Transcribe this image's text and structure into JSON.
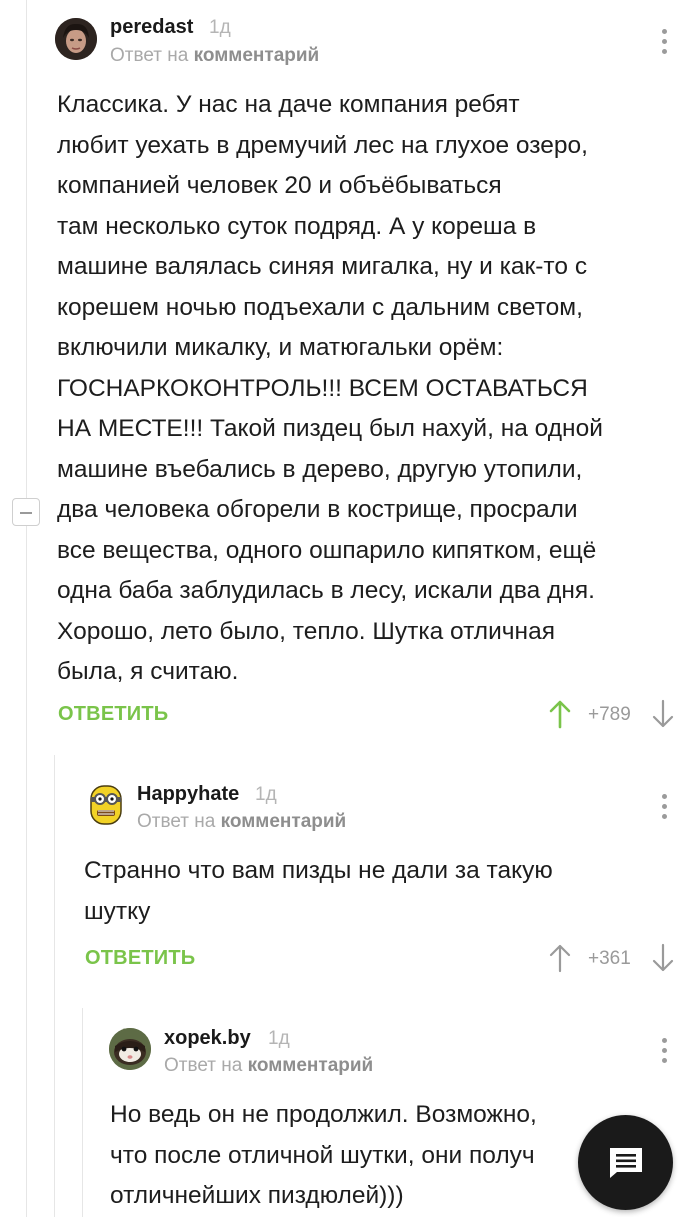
{
  "comments": [
    {
      "author": "peredast",
      "time": "1д",
      "reply_prefix": "Ответ на",
      "reply_link": "комментарий",
      "lines": [
        "Классика. У нас на даче компания ребят",
        "любит уехать в дремучий лес на глухое озеро,",
        "компанией человек 20 и объёбываться",
        "там несколько суток подряд. А у кореша в",
        "машине валялась синяя мигалка, ну и как-то с",
        "корешем ночью подъехали с дальним светом,",
        "включили микалку, и матюгальки орём:",
        "ГОСНАРКОКОНТРОЛЬ!!! ВСЕМ ОСТАВАТЬСЯ",
        "НА МЕСТЕ!!! Такой пиздец был нахуй, на одной",
        "машине въебались в дерево, другую утопили,",
        "два человека обгорели в кострище, просрали",
        "все вещества, одного ошпарило кипятком, ещё",
        "одна баба заблудилась в лесу, искали два дня.",
        "Хорошо, лето было, тепло. Шутка отличная",
        "была, я считаю."
      ],
      "reply_label": "ОТВЕТИТЬ",
      "rating": "+789",
      "voted": "up"
    },
    {
      "author": "Happyhate",
      "time": "1д",
      "reply_prefix": "Ответ на",
      "reply_link": "комментарий",
      "lines": [
        "Странно что вам пизды не дали за такую",
        "шутку"
      ],
      "reply_label": "ОТВЕТИТЬ",
      "rating": "+361",
      "voted": "none"
    },
    {
      "author": "xopek.by",
      "time": "1д",
      "reply_prefix": "Ответ на",
      "reply_link": "комментарий",
      "lines": [
        "Но ведь он не продолжил. Возможно,",
        "что после отличной шутки, они получ",
        "отличнейших пиздюлей)))"
      ]
    }
  ],
  "colors": {
    "accent_green": "#7ac44a",
    "fab_background": "#1a1a1a"
  },
  "icons": {
    "fab": "comment-icon",
    "vote_up": "arrow-up-icon",
    "vote_down": "arrow-down-icon",
    "more": "more-vertical-icon",
    "collapse": "minus-icon"
  }
}
